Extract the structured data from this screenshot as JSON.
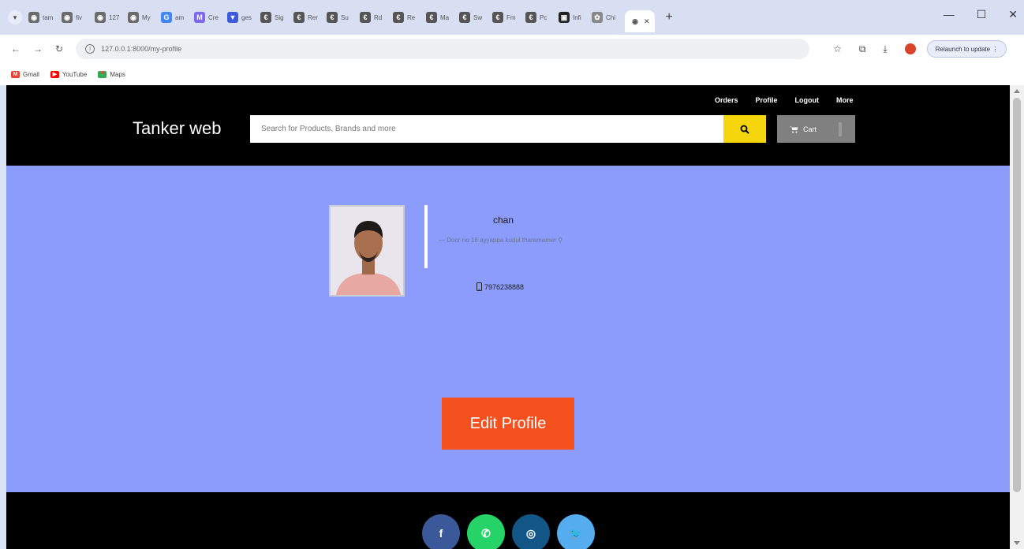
{
  "browser": {
    "tabs": [
      {
        "label": "tam",
        "color": "#6b6b6b",
        "glyph": "◉"
      },
      {
        "label": "fiv",
        "color": "#6b6b6b",
        "glyph": "◉"
      },
      {
        "label": "127",
        "color": "#6b6b6b",
        "glyph": "◉"
      },
      {
        "label": "My",
        "color": "#6b6b6b",
        "glyph": "◉"
      },
      {
        "label": "am",
        "color": "#4285f4",
        "glyph": "G"
      },
      {
        "label": "Cre",
        "color": "#7b68ee",
        "glyph": "M"
      },
      {
        "label": "ges",
        "color": "#3b5bdb",
        "glyph": "▼"
      },
      {
        "label": "Sig",
        "color": "#555",
        "glyph": "€"
      },
      {
        "label": "Rer",
        "color": "#555",
        "glyph": "€"
      },
      {
        "label": "Su",
        "color": "#555",
        "glyph": "€"
      },
      {
        "label": "Rd",
        "color": "#555",
        "glyph": "€"
      },
      {
        "label": "Re",
        "color": "#555",
        "glyph": "€"
      },
      {
        "label": "Ma",
        "color": "#555",
        "glyph": "€"
      },
      {
        "label": "Sw",
        "color": "#555",
        "glyph": "€"
      },
      {
        "label": "Fm",
        "color": "#555",
        "glyph": "€"
      },
      {
        "label": "Pc",
        "color": "#555",
        "glyph": "€"
      },
      {
        "label": "Infi",
        "color": "#222",
        "glyph": "▣"
      },
      {
        "label": "Chi",
        "color": "#888",
        "glyph": "✿"
      }
    ],
    "active_tab_glyph": "◉",
    "url": "127.0.0.1:8000/my-profile",
    "relaunch_label": "Relaunch to update",
    "bookmarks": [
      {
        "label": "Gmail",
        "glyph": "M",
        "color": "#ea4335"
      },
      {
        "label": "YouTube",
        "glyph": "▶",
        "color": "#ff0000"
      },
      {
        "label": "Maps",
        "glyph": "📍",
        "color": "#34a853"
      }
    ]
  },
  "header": {
    "nav": [
      "Orders",
      "Profile",
      "Logout",
      "More"
    ],
    "brand": "Tanker web",
    "search_placeholder": "Search for Products, Brands and more",
    "cart_label": "Cart"
  },
  "profile": {
    "name": "chan",
    "address": "— Door no 18 ayyappa kudul tharamamer",
    "phone": "7976238888",
    "edit_label": "Edit Profile"
  },
  "footer": {
    "social": [
      {
        "name": "facebook",
        "glyph": "f",
        "color": "#3b5998"
      },
      {
        "name": "whatsapp",
        "glyph": "✆",
        "color": "#25d366"
      },
      {
        "name": "instagram",
        "glyph": "◎",
        "color": "#125688"
      },
      {
        "name": "twitter",
        "glyph": "🐦",
        "color": "#55acee"
      }
    ]
  }
}
